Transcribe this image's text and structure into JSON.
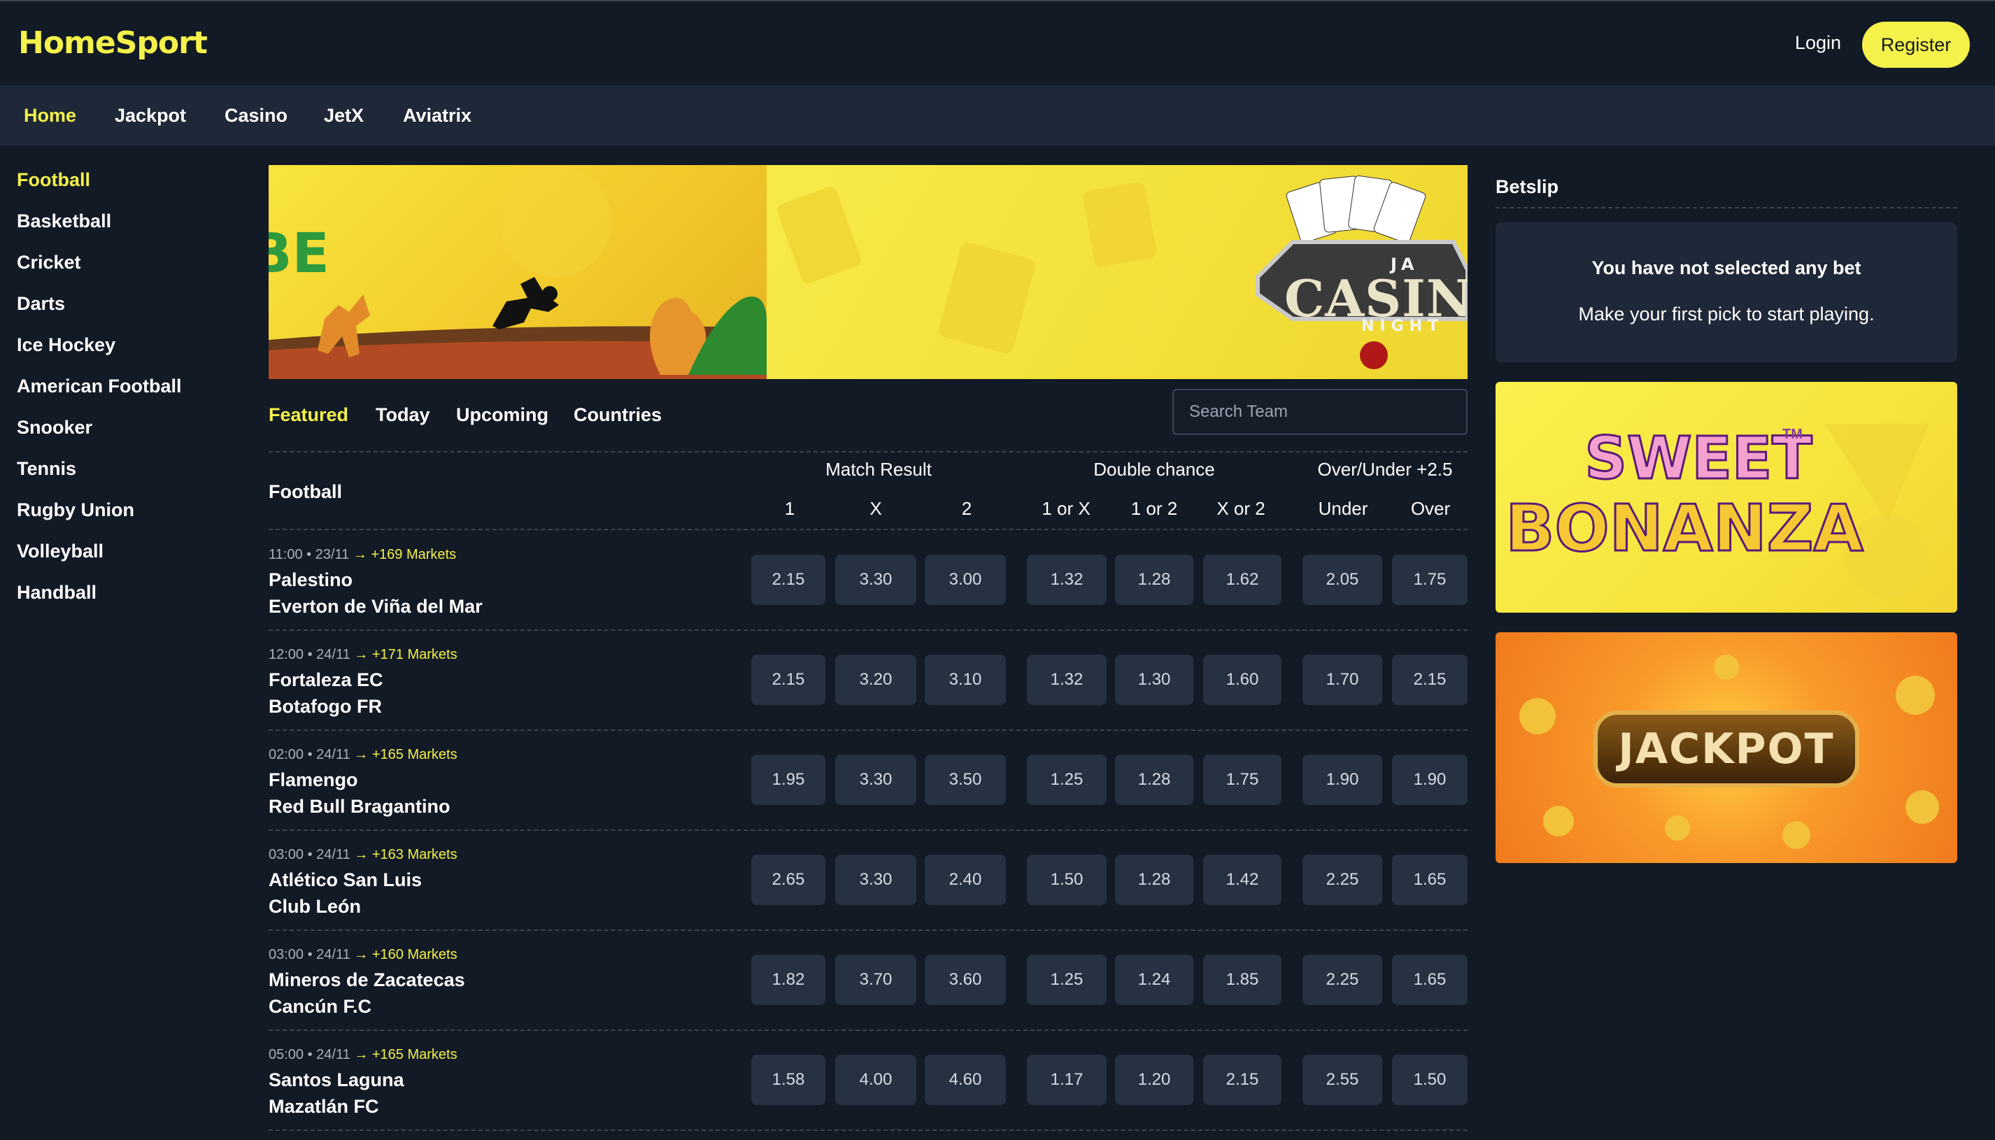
{
  "header": {
    "logo": "HomeSport",
    "login": "Login",
    "register": "Register"
  },
  "nav": {
    "items": [
      "Home",
      "Jackpot",
      "Casino",
      "JetX",
      "Aviatrix"
    ],
    "active": "Home"
  },
  "sidebar": {
    "items": [
      "Football",
      "Basketball",
      "Cricket",
      "Darts",
      "Ice Hockey",
      "American Football",
      "Snooker",
      "Tennis",
      "Rugby Union",
      "Volleyball",
      "Handball"
    ],
    "active": "Football"
  },
  "banner": {
    "casino_top": "JA",
    "casino_main": "CASINO",
    "casino_bottom": "NIGHT",
    "left_text": "BE"
  },
  "tabs": {
    "items": [
      "Featured",
      "Today",
      "Upcoming",
      "Countries"
    ],
    "active": "Featured"
  },
  "search": {
    "placeholder": "Search Team"
  },
  "table": {
    "sport": "Football",
    "groups": [
      "Match Result",
      "Double chance",
      "Over/Under +2.5"
    ],
    "columns": [
      "1",
      "X",
      "2",
      "1 or X",
      "1 or 2",
      "X or 2",
      "Under",
      "Over"
    ],
    "matches": [
      {
        "time": "11:00 • 23/11",
        "markets": "+169 Markets",
        "home": "Palestino",
        "away": "Everton de Viña del Mar",
        "odds": [
          "2.15",
          "3.30",
          "3.00",
          "1.32",
          "1.28",
          "1.62",
          "2.05",
          "1.75"
        ]
      },
      {
        "time": "12:00 • 24/11",
        "markets": "+171 Markets",
        "home": "Fortaleza EC",
        "away": "Botafogo FR",
        "odds": [
          "2.15",
          "3.20",
          "3.10",
          "1.32",
          "1.30",
          "1.60",
          "1.70",
          "2.15"
        ]
      },
      {
        "time": "02:00 • 24/11",
        "markets": "+165 Markets",
        "home": "Flamengo",
        "away": "Red Bull Bragantino",
        "odds": [
          "1.95",
          "3.30",
          "3.50",
          "1.25",
          "1.28",
          "1.75",
          "1.90",
          "1.90"
        ]
      },
      {
        "time": "03:00 • 24/11",
        "markets": "+163 Markets",
        "home": "Atlético San Luis",
        "away": "Club León",
        "odds": [
          "2.65",
          "3.30",
          "2.40",
          "1.50",
          "1.28",
          "1.42",
          "2.25",
          "1.65"
        ]
      },
      {
        "time": "03:00 • 24/11",
        "markets": "+160 Markets",
        "home": "Mineros de Zacatecas",
        "away": "Cancún F.C",
        "odds": [
          "1.82",
          "3.70",
          "3.60",
          "1.25",
          "1.24",
          "1.85",
          "2.25",
          "1.65"
        ]
      },
      {
        "time": "05:00 • 24/11",
        "markets": "+165 Markets",
        "home": "Santos Laguna",
        "away": "Mazatlán FC",
        "odds": [
          "1.58",
          "4.00",
          "4.60",
          "1.17",
          "1.20",
          "2.15",
          "2.55",
          "1.50"
        ]
      }
    ]
  },
  "betslip": {
    "title": "Betslip",
    "empty_title": "You have not selected any bet",
    "empty_subtitle": "Make your first pick to start playing."
  },
  "promos": {
    "sweet_line1": "SWEET",
    "sweet_line2": "BONANZA",
    "sweet_tm": "TM",
    "jackpot": "JACKPOT"
  },
  "colors": {
    "background": "#121a26",
    "nav_background": "#1e2838",
    "accent": "#f4f14a",
    "odds_button": "#263142"
  }
}
